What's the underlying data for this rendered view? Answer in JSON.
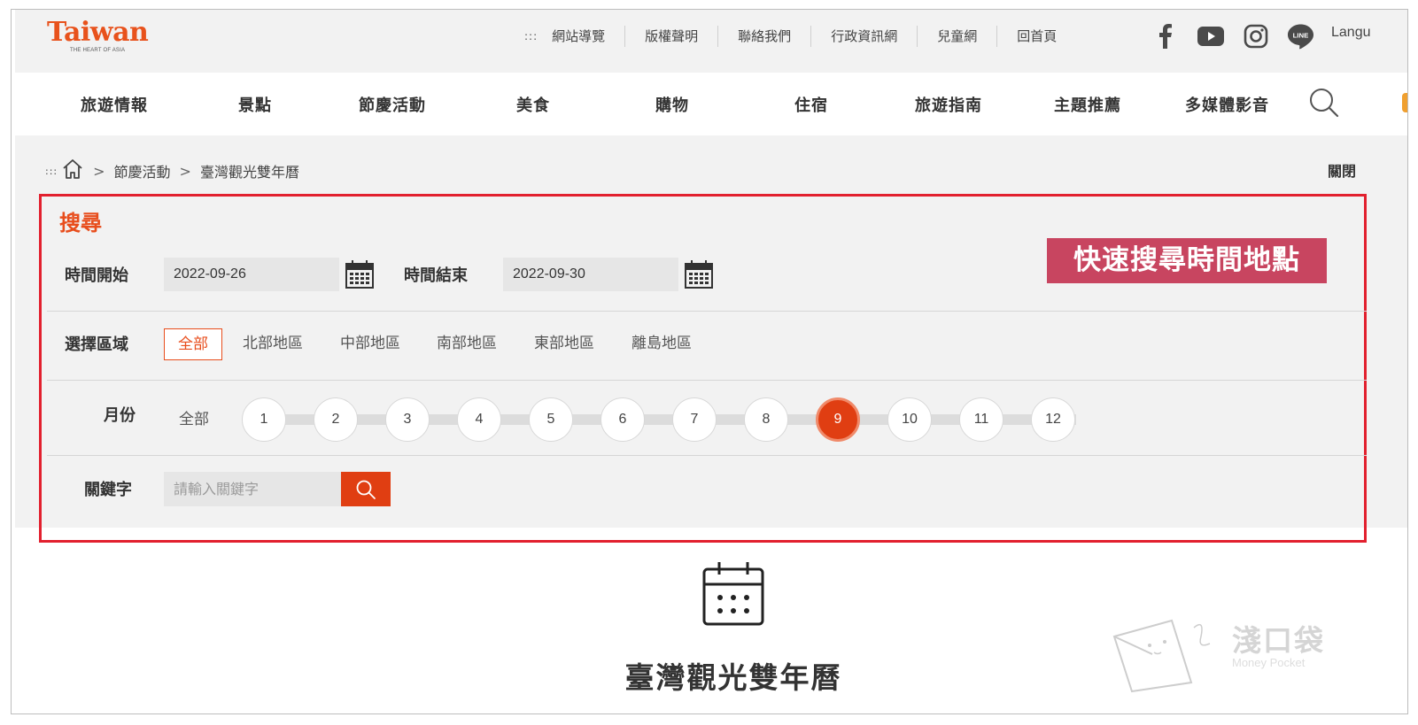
{
  "header": {
    "logo_text": "Taiwan",
    "logo_tagline": "THE HEART OF ASIA",
    "utility_dots": ":::",
    "utility_links": [
      "網站導覽",
      "版權聲明",
      "聯絡我們",
      "行政資訊網",
      "兒童網",
      "回首頁"
    ],
    "social_icons": [
      "facebook-icon",
      "youtube-icon",
      "instagram-icon",
      "line-icon"
    ],
    "language_label": "Langu"
  },
  "nav": {
    "items": [
      "旅遊情報",
      "景點",
      "節慶活動",
      "美食",
      "購物",
      "住宿",
      "旅遊指南",
      "主題推薦",
      "多媒體影音"
    ],
    "search_icon": "search-icon"
  },
  "breadcrumb": {
    "dots": ":::",
    "home_icon": "home-icon",
    "separator": ">",
    "items": [
      "節慶活動",
      "臺灣觀光雙年曆"
    ],
    "close_label": "關閉"
  },
  "search": {
    "title": "搜尋",
    "start_label": "時間開始",
    "start_value": "2022-09-26",
    "end_label": "時間結束",
    "end_value": "2022-09-30",
    "banner": "快速搜尋時間地點",
    "region_label": "選擇區域",
    "regions": [
      "全部",
      "北部地區",
      "中部地區",
      "南部地區",
      "東部地區",
      "離島地區"
    ],
    "region_selected": "全部",
    "month_label": "月份",
    "month_all": "全部",
    "months": [
      "1",
      "2",
      "3",
      "4",
      "5",
      "6",
      "7",
      "8",
      "9",
      "10",
      "11",
      "12"
    ],
    "month_selected": "9",
    "keyword_label": "關鍵字",
    "keyword_placeholder": "請輸入關鍵字"
  },
  "page": {
    "heading": "臺灣觀光雙年曆",
    "heading_icon": "calendar-icon"
  },
  "watermark": {
    "zh": "淺口袋",
    "en": "Money Pocket"
  },
  "colors": {
    "accent": "#e03e12",
    "highlight_border": "#e2202e",
    "banner_bg": "#c84560",
    "panel_bg": "#f2f2f2"
  }
}
